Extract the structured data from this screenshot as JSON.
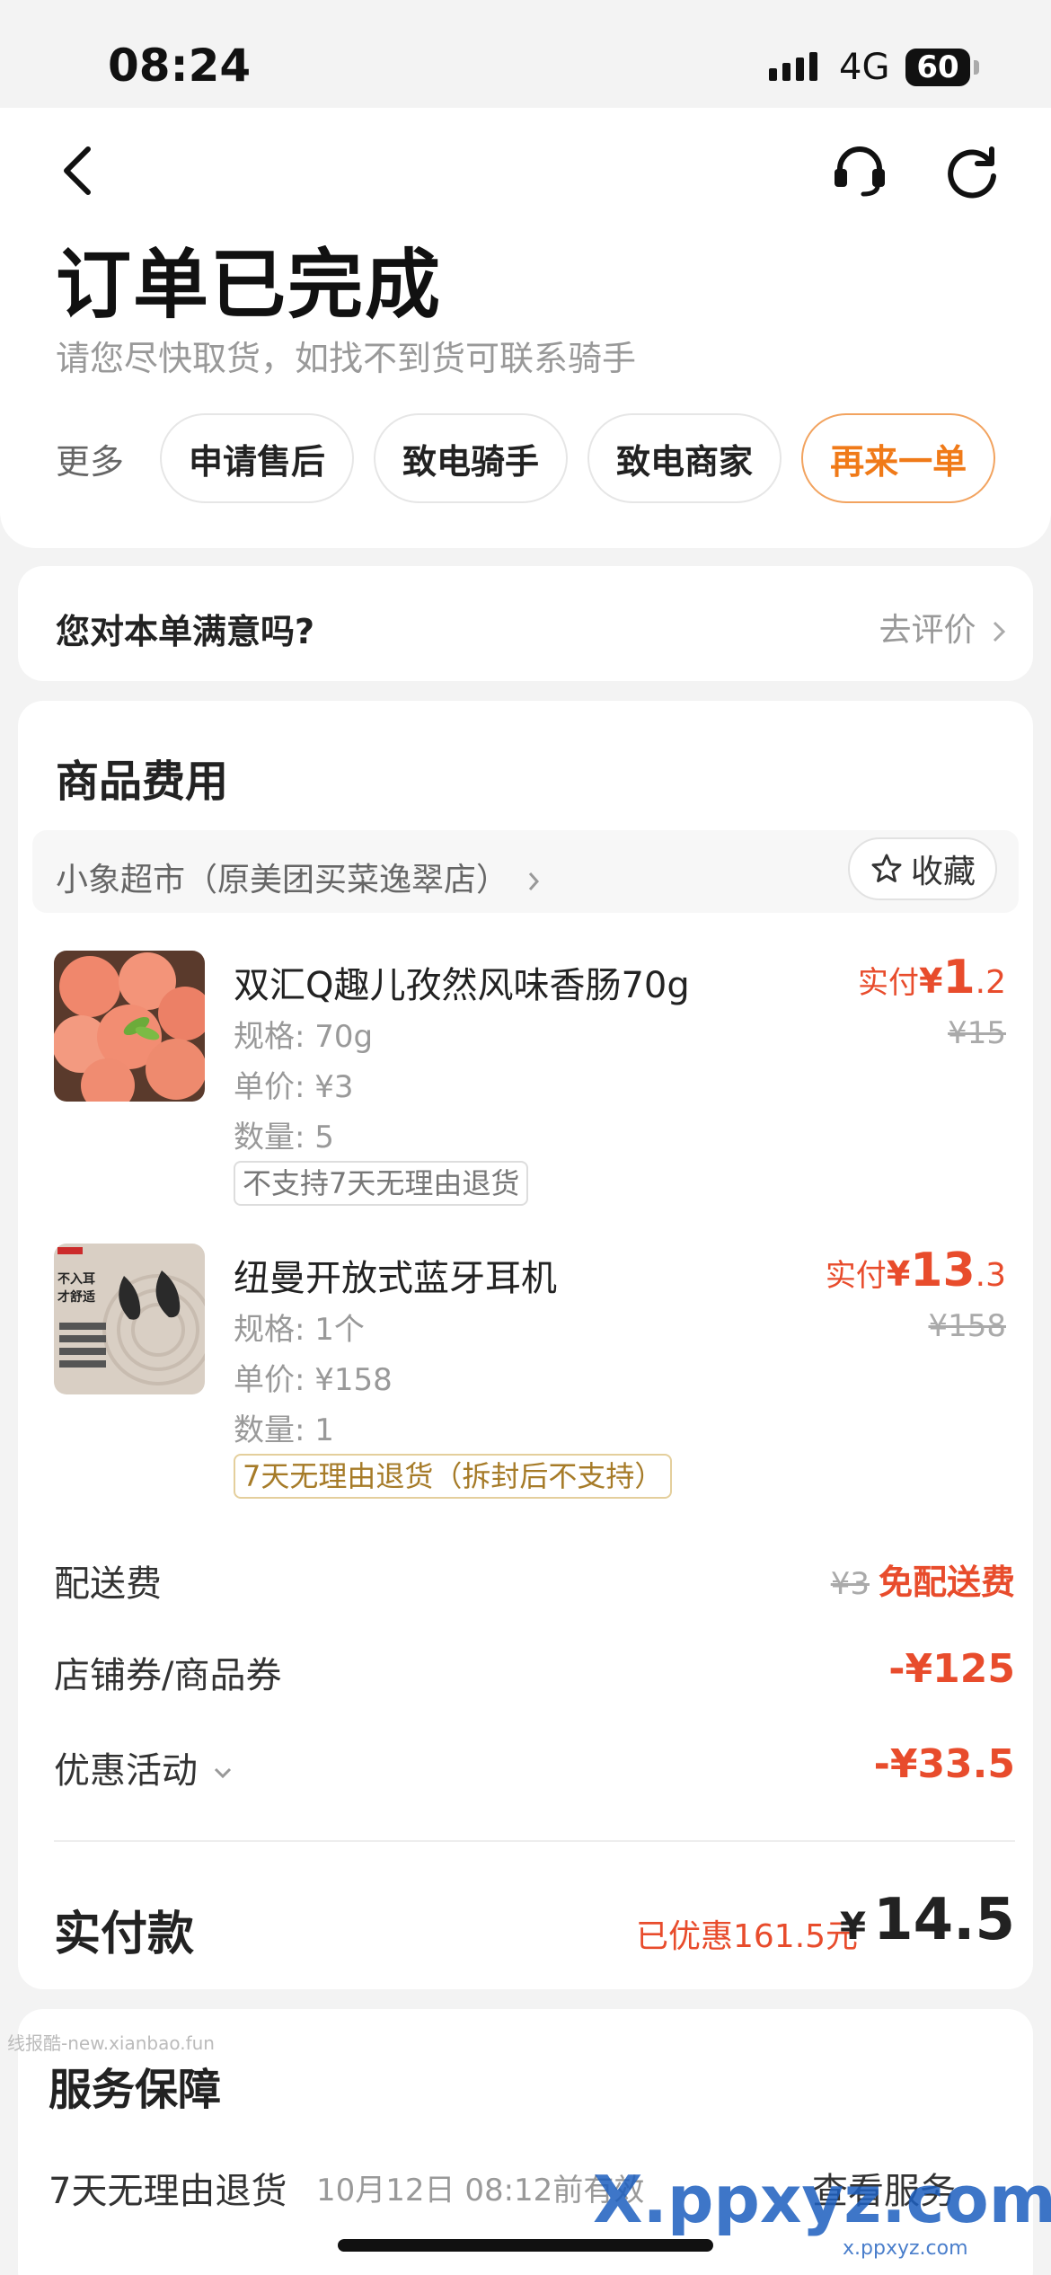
{
  "status_bar": {
    "time": "08:24",
    "network": "4G",
    "battery": "60"
  },
  "header": {
    "title": "订单已完成",
    "subtitle": "请您尽快取货，如找不到货可联系骑手",
    "more_label": "更多",
    "actions": [
      "申请售后",
      "致电骑手",
      "致电商家",
      "再来一单"
    ]
  },
  "satisfaction": {
    "question": "您对本单满意吗?",
    "link": "去评价"
  },
  "goods": {
    "section_title": "商品费用",
    "store_name": "小象超市（原美团买菜逸翠店）",
    "favorite_label": "收藏",
    "items": [
      {
        "name": "双汇Q趣儿孜然风味香肠70g",
        "spec": "规格: 70g",
        "unit_price": "单价: ¥3",
        "quantity": "数量: 5",
        "tag": "不支持7天无理由退货",
        "paid_label": "实付",
        "currency": "¥",
        "paid_int": "1",
        "paid_dec": ".2",
        "original_price": "¥15"
      },
      {
        "name": "纽曼开放式蓝牙耳机",
        "spec": "规格: 1个",
        "unit_price": "单价: ¥158",
        "quantity": "数量: 1",
        "tag": "7天无理由退货（拆封后不支持）",
        "paid_label": "实付",
        "currency": "¥",
        "paid_int": "13",
        "paid_dec": ".3",
        "original_price": "¥158",
        "image_text": "不入耳 才舒适"
      }
    ]
  },
  "fees": {
    "delivery_label": "配送费",
    "delivery_original": "¥3",
    "delivery_value": "免配送费",
    "coupon_label": "店铺券/商品券",
    "coupon_value": "-¥125",
    "promo_label": "优惠活动",
    "promo_value": "-¥33.5"
  },
  "total": {
    "label": "实付款",
    "discount_note": "已优惠161.5元",
    "currency": "¥",
    "value": "14.5"
  },
  "service": {
    "title": "服务保障",
    "name": "7天无理由退货",
    "date": "10月12日 08:12前有效",
    "link": "查看服务"
  },
  "watermarks": {
    "left": "线报酷-new.xianbao.fun",
    "right": "X.ppxyz.com",
    "right_sub": "x.ppxyz.com"
  }
}
